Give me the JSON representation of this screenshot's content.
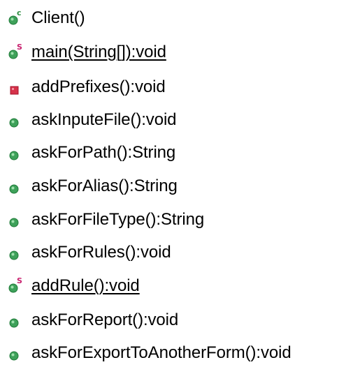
{
  "colors": {
    "public_green": "#3ea15a",
    "public_green_dark": "#1f7a38",
    "private_red": "#d6324a",
    "private_red_dark": "#a5122b",
    "static_magenta": "#c8206e",
    "constructor_green": "#2f8f42",
    "text": "#000000",
    "background": "#ffffff"
  },
  "outline": {
    "items": [
      {
        "label": "Client()",
        "icon": "constructor-icon",
        "badge": "c",
        "static": false
      },
      {
        "label": "main(String[]):void",
        "icon": "static-public-method-icon",
        "badge": "S",
        "static": true
      },
      {
        "label": "addPrefixes():void",
        "icon": "private-method-icon",
        "badge": "",
        "static": false
      },
      {
        "label": "askInputeFile():void",
        "icon": "public-method-icon",
        "badge": "",
        "static": false
      },
      {
        "label": "askForPath():String",
        "icon": "public-method-icon",
        "badge": "",
        "static": false
      },
      {
        "label": "askForAlias():String",
        "icon": "public-method-icon",
        "badge": "",
        "static": false
      },
      {
        "label": "askForFileType():String",
        "icon": "public-method-icon",
        "badge": "",
        "static": false
      },
      {
        "label": "askForRules():void",
        "icon": "public-method-icon",
        "badge": "",
        "static": false
      },
      {
        "label": "addRule():void",
        "icon": "static-public-method-icon",
        "badge": "S",
        "static": true
      },
      {
        "label": "askForReport():void",
        "icon": "public-method-icon",
        "badge": "",
        "static": false
      },
      {
        "label": "askForExportToAnotherForm():void",
        "icon": "public-method-icon",
        "badge": "",
        "static": false
      }
    ]
  }
}
